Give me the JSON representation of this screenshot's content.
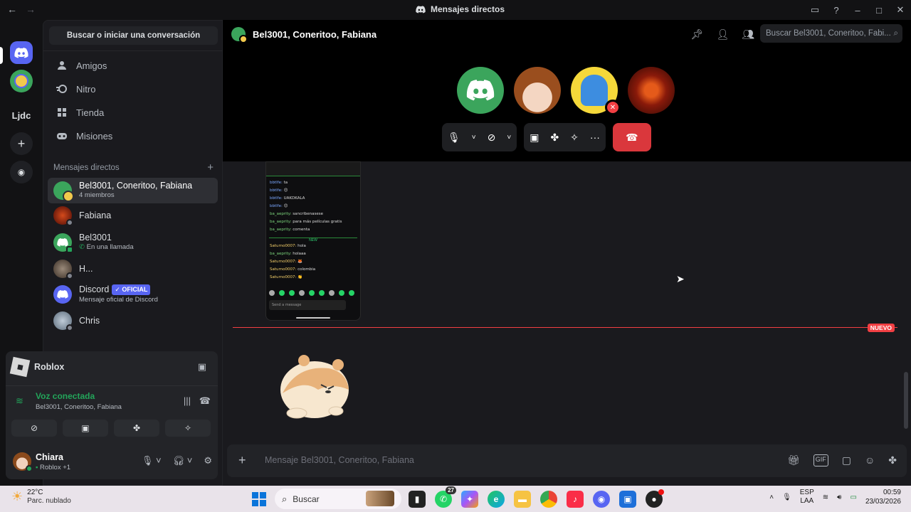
{
  "window": {
    "title": "Mensajes directos"
  },
  "sidebar": {
    "search_label": "Buscar o iniciar una conversación",
    "nav": [
      {
        "label": "Amigos",
        "icon": "friends-icon"
      },
      {
        "label": "Nitro",
        "icon": "nitro-icon"
      },
      {
        "label": "Tienda",
        "icon": "shop-icon"
      },
      {
        "label": "Misiones",
        "icon": "quests-icon"
      }
    ],
    "dm_header": "Mensajes directos",
    "dms": [
      {
        "name": "Bel3001, Coneritoo, Fabiana",
        "sub": "4 miembros",
        "color": "#3ba55c",
        "active": true
      },
      {
        "name": "Fabiana",
        "sub": "",
        "color": "#8b2a1a"
      },
      {
        "name": "Bel3001",
        "sub": "En una llamada",
        "color": "#3ba55c"
      },
      {
        "name": "H...",
        "sub": "",
        "color": "#5a4a3a"
      },
      {
        "name": "Discord",
        "sub": "Mensaje oficial de Discord",
        "badge": "✓ OFICIAL",
        "color": "#5865f2"
      },
      {
        "name": "Chris",
        "sub": "",
        "color": "#8a9aaa"
      }
    ]
  },
  "rail": {
    "server_text": "Ljdc"
  },
  "panel": {
    "activity": "Roblox",
    "voice_title": "Voz conectada",
    "voice_sub": "Bel3001, Coneritoo, Fabiana",
    "user_name": "Chiara",
    "user_sub": "Roblox +1"
  },
  "call": {
    "title": "Bel3001, Coneritoo, Fabiana",
    "search_placeholder": "Buscar Bel3001, Coneritoo, Fabi..."
  },
  "chat": {
    "new_badge": "NUEVO",
    "composer_placeholder": "Mensaje Bel3001, Coneritoo, Fabiana",
    "phone_lines": [
      "bbtlfe: ta",
      "bbtlfe: 😊",
      "bbtlfe: UAKDKALA",
      "bbtlfe: 😊",
      "ba_aeprity: sancribenasese",
      "ba_aeprity: para más películas gratis",
      "ba_aeprity: comenta",
      "Saturno0007: hola",
      "ba_aeprity: holaaa",
      "Saturno0007: 🦊",
      "Saturno0007: colombia",
      "Saturno0007: 👏"
    ],
    "phone_new": "NEW",
    "phone_input": "Send a message"
  },
  "taskbar": {
    "weather_temp": "22°C",
    "weather_desc": "Parc. nublado",
    "search": "Buscar",
    "lang_top": "ESP",
    "lang_bottom": "LAA",
    "time": "00:59",
    "date": "23/03/2026",
    "whatsapp_count": "27"
  }
}
